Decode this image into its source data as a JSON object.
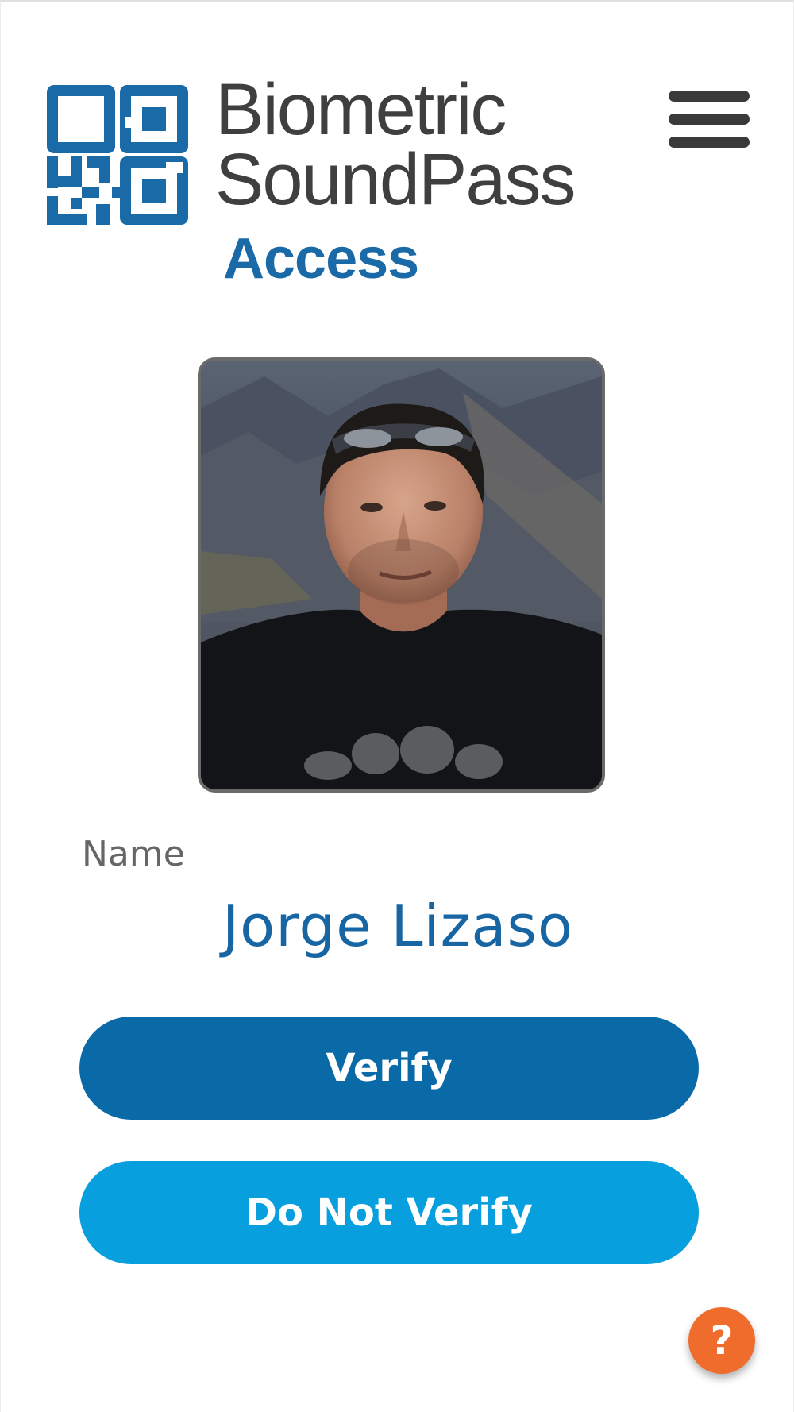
{
  "header": {
    "brand_line1": "Biometric",
    "brand_line2": "SoundPass",
    "brand_access": "Access",
    "logo_icon": "qr-code-logo-icon",
    "menu_icon": "hamburger-menu-icon"
  },
  "profile": {
    "photo_alt": "profile photo",
    "name_label": "Name",
    "name_value": "Jorge Lizaso"
  },
  "actions": {
    "verify_label": "Verify",
    "do_not_verify_label": "Do Not Verify"
  },
  "help": {
    "label": "?",
    "icon": "help-icon"
  },
  "colors": {
    "brand_blue": "#1b6aa8",
    "verify_button": "#0a6aa8",
    "do_not_verify_button": "#079fdd",
    "help_button": "#ef6c2c",
    "logo_gray": "#3f3f3f"
  }
}
